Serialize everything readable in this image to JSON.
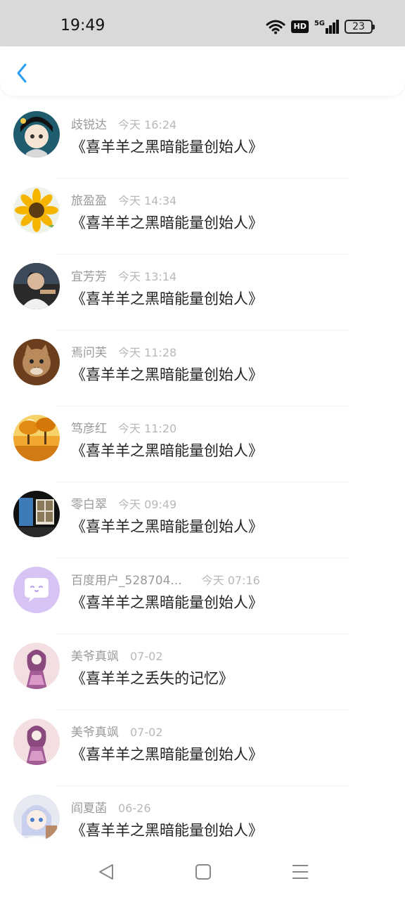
{
  "status_bar": {
    "time": "19:49",
    "hd": "HD",
    "network": "5G",
    "battery": "23"
  },
  "header": {
    "back_icon": "chevron-left-icon"
  },
  "items": [
    {
      "name": "歧锐达",
      "time": "今天 16:24",
      "title": "《喜羊羊之黑暗能量创始人》",
      "avatar": "anime-girl-avatar"
    },
    {
      "name": "旅盈盈",
      "time": "今天 14:34",
      "title": "《喜羊羊之黑暗能量创始人》",
      "avatar": "sunflower-avatar"
    },
    {
      "name": "宜芳芳",
      "time": "今天 13:14",
      "title": "《喜羊羊之黑暗能量创始人》",
      "avatar": "boy-avatar"
    },
    {
      "name": "焉问芙",
      "time": "今天 11:28",
      "title": "《喜羊羊之黑暗能量创始人》",
      "avatar": "cat-avatar"
    },
    {
      "name": "笃彦红",
      "time": "今天 11:20",
      "title": "《喜羊羊之黑暗能量创始人》",
      "avatar": "autumn-avatar"
    },
    {
      "name": "零白翠",
      "time": "今天 09:49",
      "title": "《喜羊羊之黑暗能量创始人》",
      "avatar": "window-avatar"
    },
    {
      "name": "百度用户_528704...",
      "time": "今天 07:16",
      "title": "《喜羊羊之黑暗能量创始人》",
      "avatar": "default-chat-avatar"
    },
    {
      "name": "美爷真飒",
      "time": "07-02",
      "title": "《喜羊羊之丢失的记忆》",
      "avatar": "pink-girl-avatar"
    },
    {
      "name": "美爷真飒",
      "time": "07-02",
      "title": "《喜羊羊之黑暗能量创始人》",
      "avatar": "pink-girl-avatar"
    },
    {
      "name": "阎夏菡",
      "time": "06-26",
      "title": "《喜羊羊之黑暗能量创始人》",
      "avatar": "anime-blue-hair-avatar"
    }
  ],
  "nav_bar": {
    "back_icon": "triangle-back-icon",
    "home_icon": "square-home-icon",
    "menu_icon": "menu-lines-icon"
  },
  "colors": {
    "accent": "#2b9df2",
    "status_bar_bg": "#d9d9d9",
    "name_text": "#9a9a9a",
    "time_text": "#b8b8b8"
  }
}
